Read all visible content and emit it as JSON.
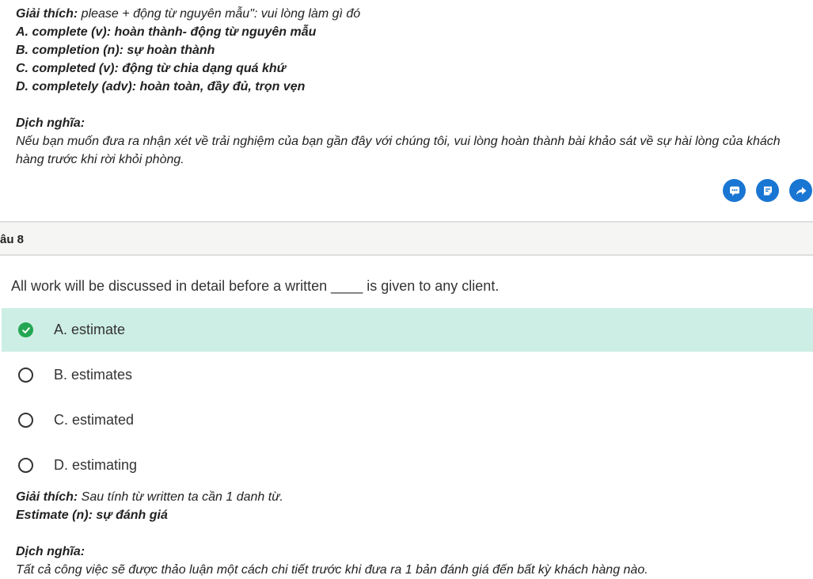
{
  "prev_explanation": {
    "intro_label": "Giải thích:",
    "intro_text": " please + động từ nguyên mẫu\": vui lòng làm gì đó",
    "items": [
      "A. complete (v): hoàn thành- động từ nguyên mẫu",
      "B. completion (n): sự hoàn thành",
      "C. completed (v): động từ chia dạng quá khứ",
      "D. completely (adv): hoàn toàn, đầy đủ, trọn vẹn"
    ],
    "translation_label": "Dịch nghĩa:",
    "translation_text": "Nếu bạn muốn đưa ra nhận xét về trải nghiệm của bạn gần đây với chúng tôi, vui lòng hoàn thành bài khảo sát về sự hài lòng của khách hàng trước khi rời khỏi phòng."
  },
  "actions": [
    {
      "icon": "comment-icon"
    },
    {
      "icon": "note-icon"
    },
    {
      "icon": "share-icon"
    }
  ],
  "question": {
    "header": "âu 8",
    "text": "All work will be discussed in detail before a written ____ is given to any client.",
    "options": [
      {
        "label": "A. estimate",
        "correct": true
      },
      {
        "label": "B. estimates",
        "correct": false
      },
      {
        "label": "C. estimated",
        "correct": false
      },
      {
        "label": "D. estimating",
        "correct": false
      }
    ]
  },
  "explanation": {
    "label": "Giải thích:",
    "text": " Sau tính từ written ta cần 1 danh từ.",
    "definition": "Estimate (n): sự đánh giá",
    "translation_label": "Dịch nghĩa:",
    "translation_text": "Tất cả công việc sẽ được thảo luận một cách chi tiết trước khi đưa ra 1 bản đánh giá đến bất kỳ khách hàng nào."
  },
  "colors": {
    "accent": "#1976d2",
    "correct_bg": "#cdeee4",
    "check": "#22a652"
  }
}
